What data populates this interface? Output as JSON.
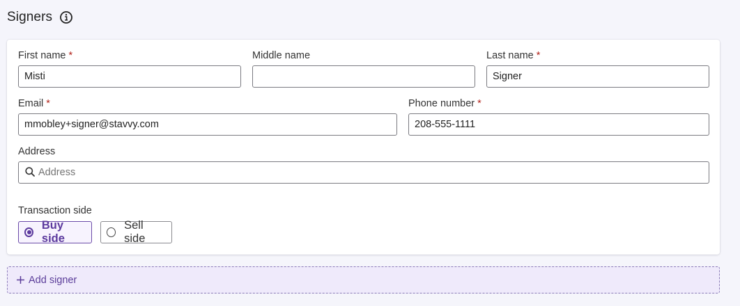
{
  "section": {
    "title": "Signers",
    "info_icon": "info-circle-icon"
  },
  "fields": {
    "first_name": {
      "label": "First name",
      "required_mark": "*",
      "value": "Misti"
    },
    "middle_name": {
      "label": "Middle name",
      "value": ""
    },
    "last_name": {
      "label": "Last name",
      "required_mark": "*",
      "value": "Signer"
    },
    "email": {
      "label": "Email",
      "required_mark": "*",
      "value": "mmobley+signer@stavvy.com"
    },
    "phone": {
      "label": "Phone number",
      "required_mark": "*",
      "value": "208-555-1111"
    },
    "address": {
      "label": "Address",
      "placeholder": "Address",
      "icon": "search-icon"
    }
  },
  "transaction_side": {
    "label": "Transaction side",
    "options": [
      {
        "label": "Buy side",
        "selected": true
      },
      {
        "label": "Sell side",
        "selected": false
      }
    ]
  },
  "add_signer": {
    "label": "Add signer",
    "icon": "plus-icon"
  },
  "colors": {
    "accent": "#5c3a9e",
    "required": "#b3261e",
    "background": "#f5f5fb"
  }
}
